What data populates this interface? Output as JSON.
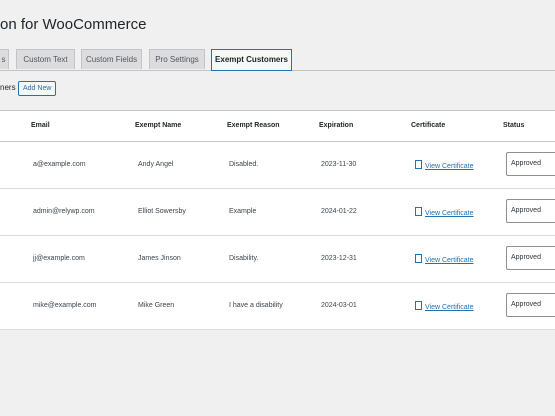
{
  "page": {
    "title": "on for WooCommerce"
  },
  "tabs": [
    {
      "label": "s",
      "active": false
    },
    {
      "label": "Custom Text",
      "active": false
    },
    {
      "label": "Custom Fields",
      "active": false
    },
    {
      "label": "Pro Settings",
      "active": false
    },
    {
      "label": "Exempt Customers",
      "active": true
    }
  ],
  "section": {
    "heading": "ners",
    "add_new_label": "Add New"
  },
  "table": {
    "headers": {
      "email": "Email",
      "exempt_name": "Exempt Name",
      "exempt_reason": "Exempt Reason",
      "expiration": "Expiration",
      "certificate": "Certificate",
      "status": "Status"
    },
    "rows": [
      {
        "email": "a@example.com",
        "name": "Andy Angel",
        "reason": "Disabled.",
        "expiration": "2023-11-30",
        "certificate": "View Certificate",
        "status": "Approved"
      },
      {
        "email": "admin@relywp.com",
        "name": "Elliot Sowersby",
        "reason": "Example",
        "expiration": "2024-01-22",
        "certificate": "View Certificate",
        "status": "Approved"
      },
      {
        "email": "jj@example.com",
        "name": "James Jinson",
        "reason": "Disability.",
        "expiration": "2023-12-31",
        "certificate": "View Certificate",
        "status": "Approved"
      },
      {
        "email": "mike@example.com",
        "name": "Mike Green",
        "reason": "I have a disability",
        "expiration": "2024-03-01",
        "certificate": "View Certificate",
        "status": "Approved"
      }
    ]
  },
  "icons": {
    "certificate": "document-icon"
  },
  "colors": {
    "link": "#2271b1",
    "background": "#f0f0f1",
    "table_bg": "#ffffff"
  }
}
